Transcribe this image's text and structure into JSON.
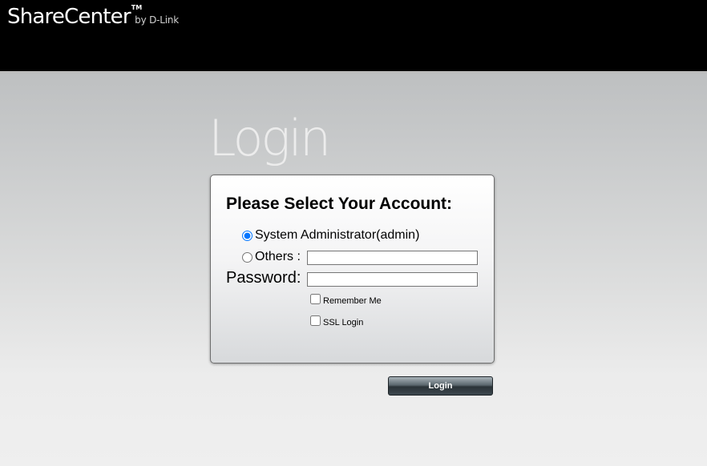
{
  "header": {
    "brand_name": "ShareCenter",
    "brand_tm": "TM",
    "brand_by": "by D-Link"
  },
  "page_title": "Login",
  "form": {
    "heading": "Please Select Your Account:",
    "account_options": [
      {
        "label": "System Administrator(admin)",
        "selected": true
      },
      {
        "label": "Others :",
        "selected": false
      }
    ],
    "others_value": "",
    "password_label": "Password:",
    "password_value": "",
    "remember_me_label": "Remember Me",
    "remember_me_checked": false,
    "ssl_login_label": "SSL Login",
    "ssl_login_checked": false
  },
  "login_button_label": "Login"
}
